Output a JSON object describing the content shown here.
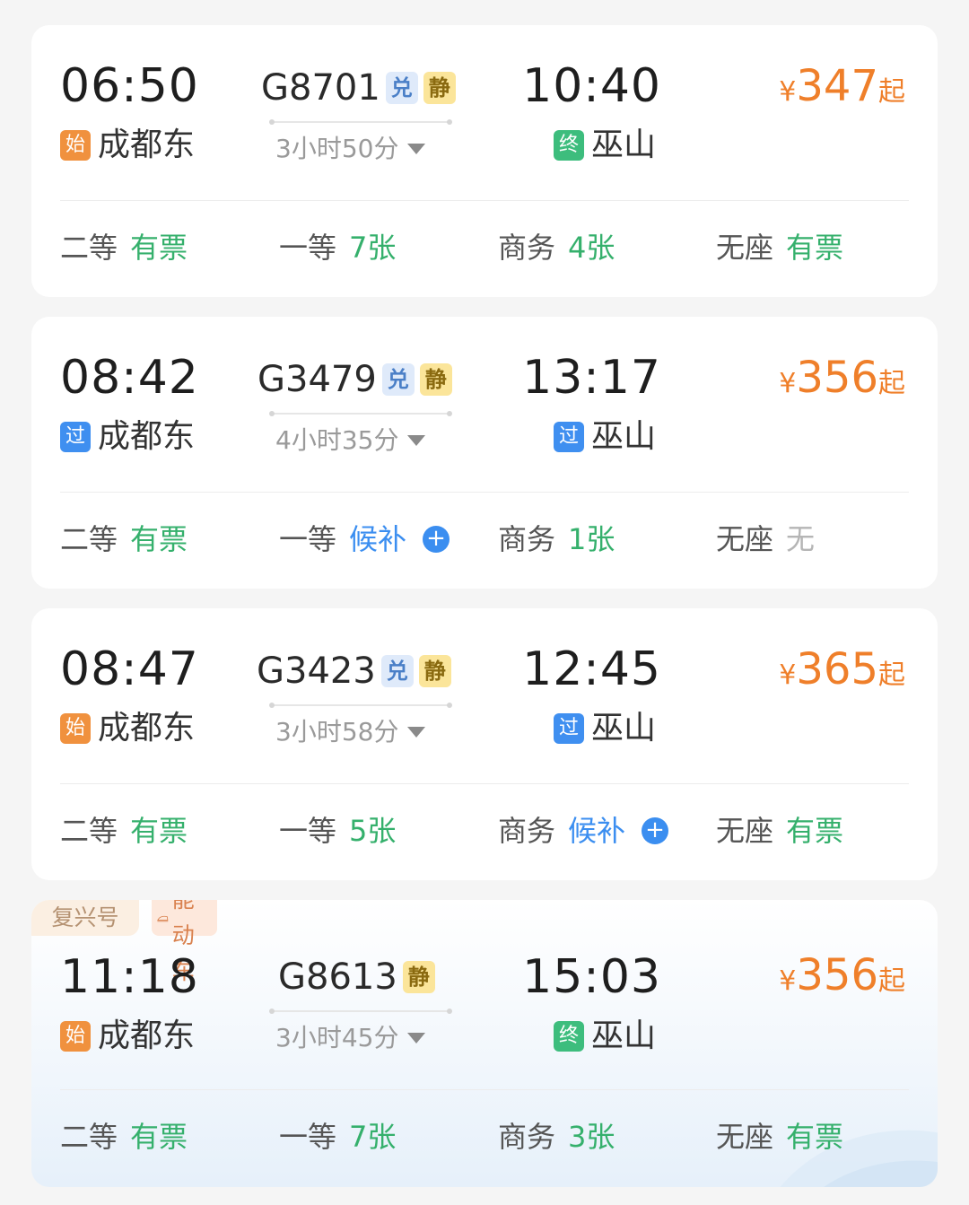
{
  "trains": [
    {
      "tags": [],
      "departure_time": "06:50",
      "departure_station": {
        "badge": "始",
        "name": "成都东"
      },
      "train_number": "G8701",
      "badges": [
        "兑",
        "静"
      ],
      "duration": "3小时50分",
      "arrival_time": "10:40",
      "arrival_station": {
        "badge": "终",
        "name": "巫山"
      },
      "price": {
        "currency": "¥",
        "amount": "347",
        "suffix": "起"
      },
      "seats": [
        {
          "class": "二等",
          "status": "有票"
        },
        {
          "class": "一等",
          "status": "7张"
        },
        {
          "class": "商务",
          "status": "4张"
        },
        {
          "class": "无座",
          "status": "有票"
        }
      ]
    },
    {
      "tags": [],
      "departure_time": "08:42",
      "departure_station": {
        "badge": "过",
        "name": "成都东"
      },
      "train_number": "G3479",
      "badges": [
        "兑",
        "静"
      ],
      "duration": "4小时35分",
      "arrival_time": "13:17",
      "arrival_station": {
        "badge": "过",
        "name": "巫山"
      },
      "price": {
        "currency": "¥",
        "amount": "356",
        "suffix": "起"
      },
      "seats": [
        {
          "class": "二等",
          "status": "有票"
        },
        {
          "class": "一等",
          "status": "候补"
        },
        {
          "class": "商务",
          "status": "1张"
        },
        {
          "class": "无座",
          "status": "无"
        }
      ]
    },
    {
      "tags": [],
      "departure_time": "08:47",
      "departure_station": {
        "badge": "始",
        "name": "成都东"
      },
      "train_number": "G3423",
      "badges": [
        "兑",
        "静"
      ],
      "duration": "3小时58分",
      "arrival_time": "12:45",
      "arrival_station": {
        "badge": "过",
        "name": "巫山"
      },
      "price": {
        "currency": "¥",
        "amount": "365",
        "suffix": "起"
      },
      "seats": [
        {
          "class": "二等",
          "status": "有票"
        },
        {
          "class": "一等",
          "status": "5张"
        },
        {
          "class": "商务",
          "status": "候补"
        },
        {
          "class": "无座",
          "status": "有票"
        }
      ]
    },
    {
      "tags": [
        "复兴号",
        "智能动车"
      ],
      "departure_time": "11:18",
      "departure_station": {
        "badge": "始",
        "name": "成都东"
      },
      "train_number": "G8613",
      "badges": [
        "静"
      ],
      "duration": "3小时45分",
      "arrival_time": "15:03",
      "arrival_station": {
        "badge": "终",
        "name": "巫山"
      },
      "price": {
        "currency": "¥",
        "amount": "356",
        "suffix": "起"
      },
      "seats": [
        {
          "class": "二等",
          "status": "有票"
        },
        {
          "class": "一等",
          "status": "7张"
        },
        {
          "class": "商务",
          "status": "3张"
        },
        {
          "class": "无座",
          "status": "有票"
        }
      ]
    }
  ],
  "colors": {
    "price": "#ef7f2a",
    "available": "#35b06c",
    "waitlist": "#3b8ef0",
    "none": "#b5b5b5",
    "badge_start": "#f0913e",
    "badge_pass": "#3f8ff0",
    "badge_end": "#3dbd7d"
  },
  "icons": {
    "waitlist_add": "plus-circle-icon",
    "duration_expand": "caret-down-icon",
    "smart_train": "train-icon"
  }
}
